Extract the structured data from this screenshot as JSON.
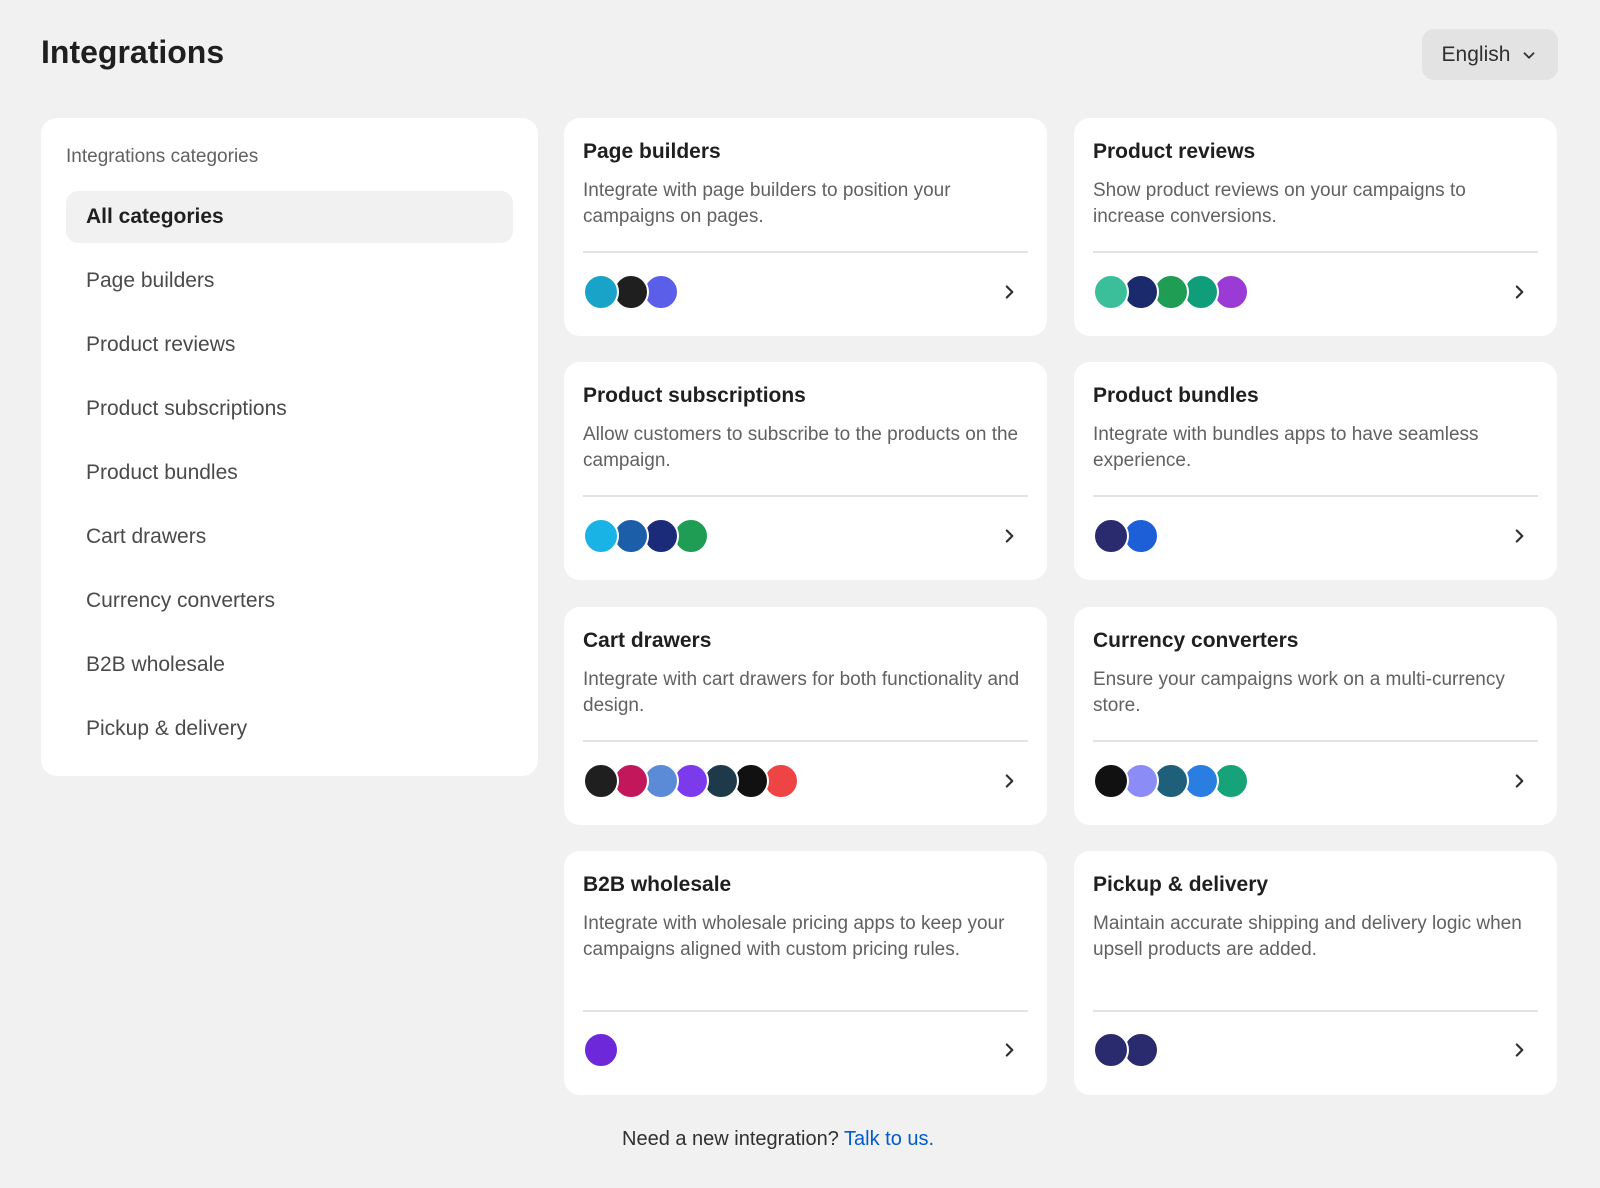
{
  "header": {
    "title": "Integrations",
    "language": "English"
  },
  "sidebar": {
    "heading": "Integrations categories",
    "items": [
      {
        "label": "All categories"
      },
      {
        "label": "Page builders"
      },
      {
        "label": "Product reviews"
      },
      {
        "label": "Product subscriptions"
      },
      {
        "label": "Product bundles"
      },
      {
        "label": "Cart drawers"
      },
      {
        "label": "Currency converters"
      },
      {
        "label": "B2B wholesale"
      },
      {
        "label": "Pickup & delivery"
      }
    ]
  },
  "cards": [
    {
      "title": "Page builders",
      "description": "Integrate with page builders to position your campaigns on pages.",
      "logos": [
        {
          "color": "#1aa3c8"
        },
        {
          "color": "#1f1f1f"
        },
        {
          "color": "#5b5ee8"
        }
      ]
    },
    {
      "title": "Product reviews",
      "description": "Show product reviews on your campaigns to increase conversions.",
      "logos": [
        {
          "color": "#3bbf9a"
        },
        {
          "color": "#1a2a6c"
        },
        {
          "color": "#1f9d55"
        },
        {
          "color": "#0f9d7a"
        },
        {
          "color": "#9b3bd6"
        }
      ]
    },
    {
      "title": "Product subscriptions",
      "description": "Allow customers to subscribe to the products on the campaign.",
      "logos": [
        {
          "color": "#1ab3e6"
        },
        {
          "color": "#1c5fa8"
        },
        {
          "color": "#1c2a7a"
        },
        {
          "color": "#1f9d55"
        }
      ]
    },
    {
      "title": "Product bundles",
      "description": "Integrate with bundles apps to have seamless experience.",
      "logos": [
        {
          "color": "#2a2a6e"
        },
        {
          "color": "#1c5fd6"
        }
      ]
    },
    {
      "title": "Cart drawers",
      "description": "Integrate with cart drawers for both functionality and design.",
      "logos": [
        {
          "color": "#1f1f1f"
        },
        {
          "color": "#c2185b"
        },
        {
          "color": "#5b8bd6"
        },
        {
          "color": "#7c3aed"
        },
        {
          "color": "#1e3a4a"
        },
        {
          "color": "#111111"
        },
        {
          "color": "#ef4444"
        }
      ]
    },
    {
      "title": "Currency converters",
      "description": "Ensure your campaigns work on a multi-currency store.",
      "logos": [
        {
          "color": "#111111"
        },
        {
          "color": "#8b8cf5"
        },
        {
          "color": "#1e5f7a"
        },
        {
          "color": "#2a7de1"
        },
        {
          "color": "#16a37a"
        }
      ]
    },
    {
      "title": "B2B wholesale",
      "description": "Integrate with wholesale pricing apps to keep your campaigns aligned with custom pricing rules.",
      "logos": [
        {
          "color": "#6d28d9"
        }
      ]
    },
    {
      "title": "Pickup & delivery",
      "description": "Maintain accurate shipping and delivery logic when upsell products are added.",
      "logos": [
        {
          "color": "#2a2a6e"
        },
        {
          "color": "#2a2a6e"
        }
      ]
    }
  ],
  "footer": {
    "text": "Need a new integration?",
    "link": "Talk to us."
  }
}
